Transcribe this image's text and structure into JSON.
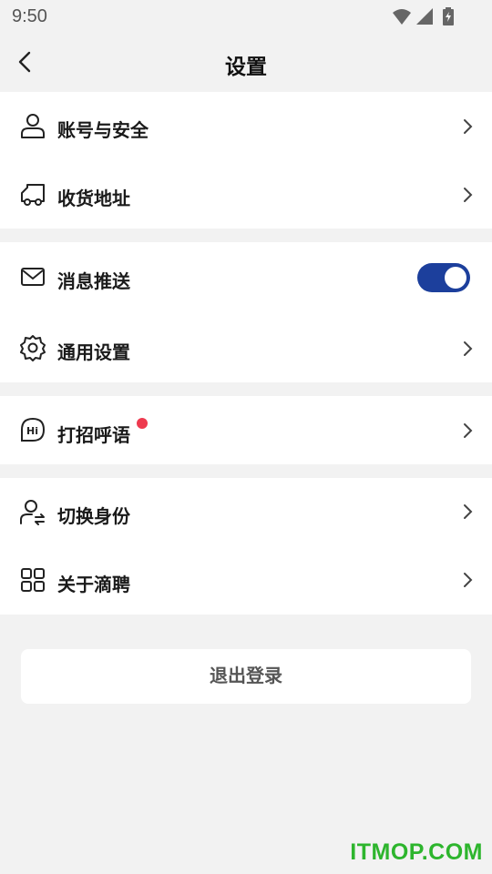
{
  "status_bar": {
    "time": "9:50"
  },
  "header": {
    "title": "设置"
  },
  "groups": [
    {
      "items": [
        {
          "label": "账号与安全",
          "icon": "user-icon"
        },
        {
          "label": "收货地址",
          "icon": "truck-icon"
        }
      ]
    },
    {
      "items": [
        {
          "label": "消息推送",
          "icon": "mail-icon",
          "toggle": true
        },
        {
          "label": "通用设置",
          "icon": "gear-icon"
        }
      ]
    },
    {
      "items": [
        {
          "label": "打招呼语",
          "icon": "hi-bubble-icon",
          "badge": "red-dot"
        }
      ]
    },
    {
      "items": [
        {
          "label": "切换身份",
          "icon": "switch-user-icon"
        },
        {
          "label": "关于滴聘",
          "icon": "grid-icon"
        }
      ]
    }
  ],
  "logout_label": "退出登录",
  "watermark": "ITMOP.COM",
  "colors": {
    "toggle_on": "#1c3f9c",
    "badge": "#ee3a4f",
    "background": "#f2f2f2"
  }
}
